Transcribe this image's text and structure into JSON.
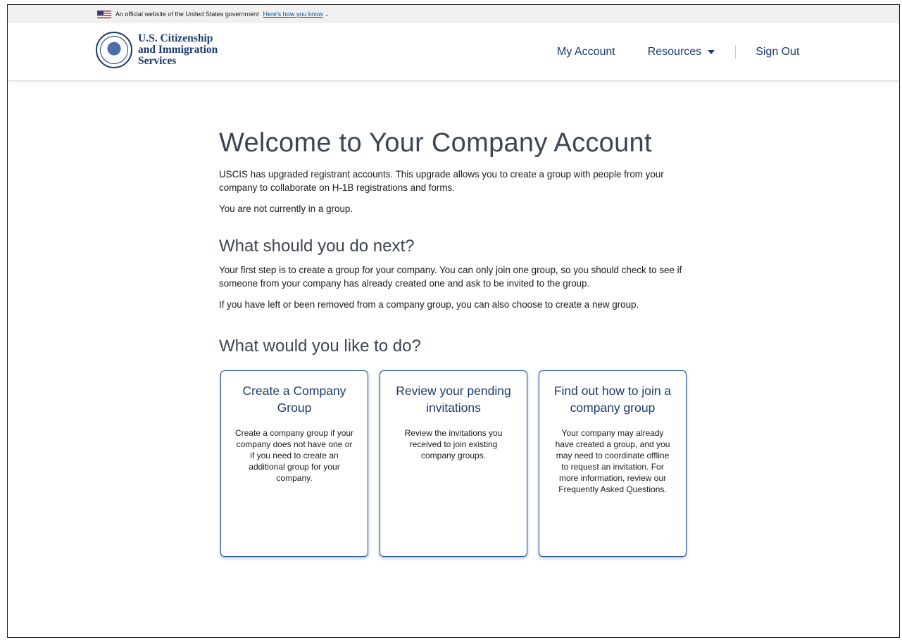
{
  "gov_banner": {
    "text": "An official website of the United States government",
    "link": "Here's how you know",
    "chevron": "⌄"
  },
  "header": {
    "agency_lines": [
      "U.S. Citizenship",
      "and Immigration",
      "Services"
    ],
    "nav": {
      "my_account": "My Account",
      "resources": "Resources",
      "sign_out": "Sign Out"
    }
  },
  "main": {
    "title": "Welcome to Your Company Account",
    "intro": "USCIS has upgraded registrant accounts. This upgrade allows you to create a group  with people from your company to collaborate on H-1B registrations and forms.",
    "status": "You are not currently in a group.",
    "next_heading": "What should you do next?",
    "next_para1": "Your first step is to create a group for your company. You can only join one group, so you should check to see if someone from your company has already created one and ask to be invited to the group.",
    "next_para2": "If you have left or been removed from a company group, you can also choose to create a new group.",
    "actions_heading": "What would you like to do?",
    "cards": [
      {
        "title": "Create a Company Group",
        "body": "Create a company group if your company does not have one or if you need to create an additional group for your company."
      },
      {
        "title": "Review your pending invitations",
        "body": "Review the invitations you received to join existing company groups."
      },
      {
        "title": "Find out how to join a company group",
        "body": "Your company may already have created a group, and you may need to coordinate offline to request an invitation. For more information, review our Frequently Asked Questions."
      }
    ]
  },
  "colors": {
    "brand_navy": "#1a3a6e",
    "link_blue": "#005ea2",
    "heading_gray": "#3d4551"
  }
}
